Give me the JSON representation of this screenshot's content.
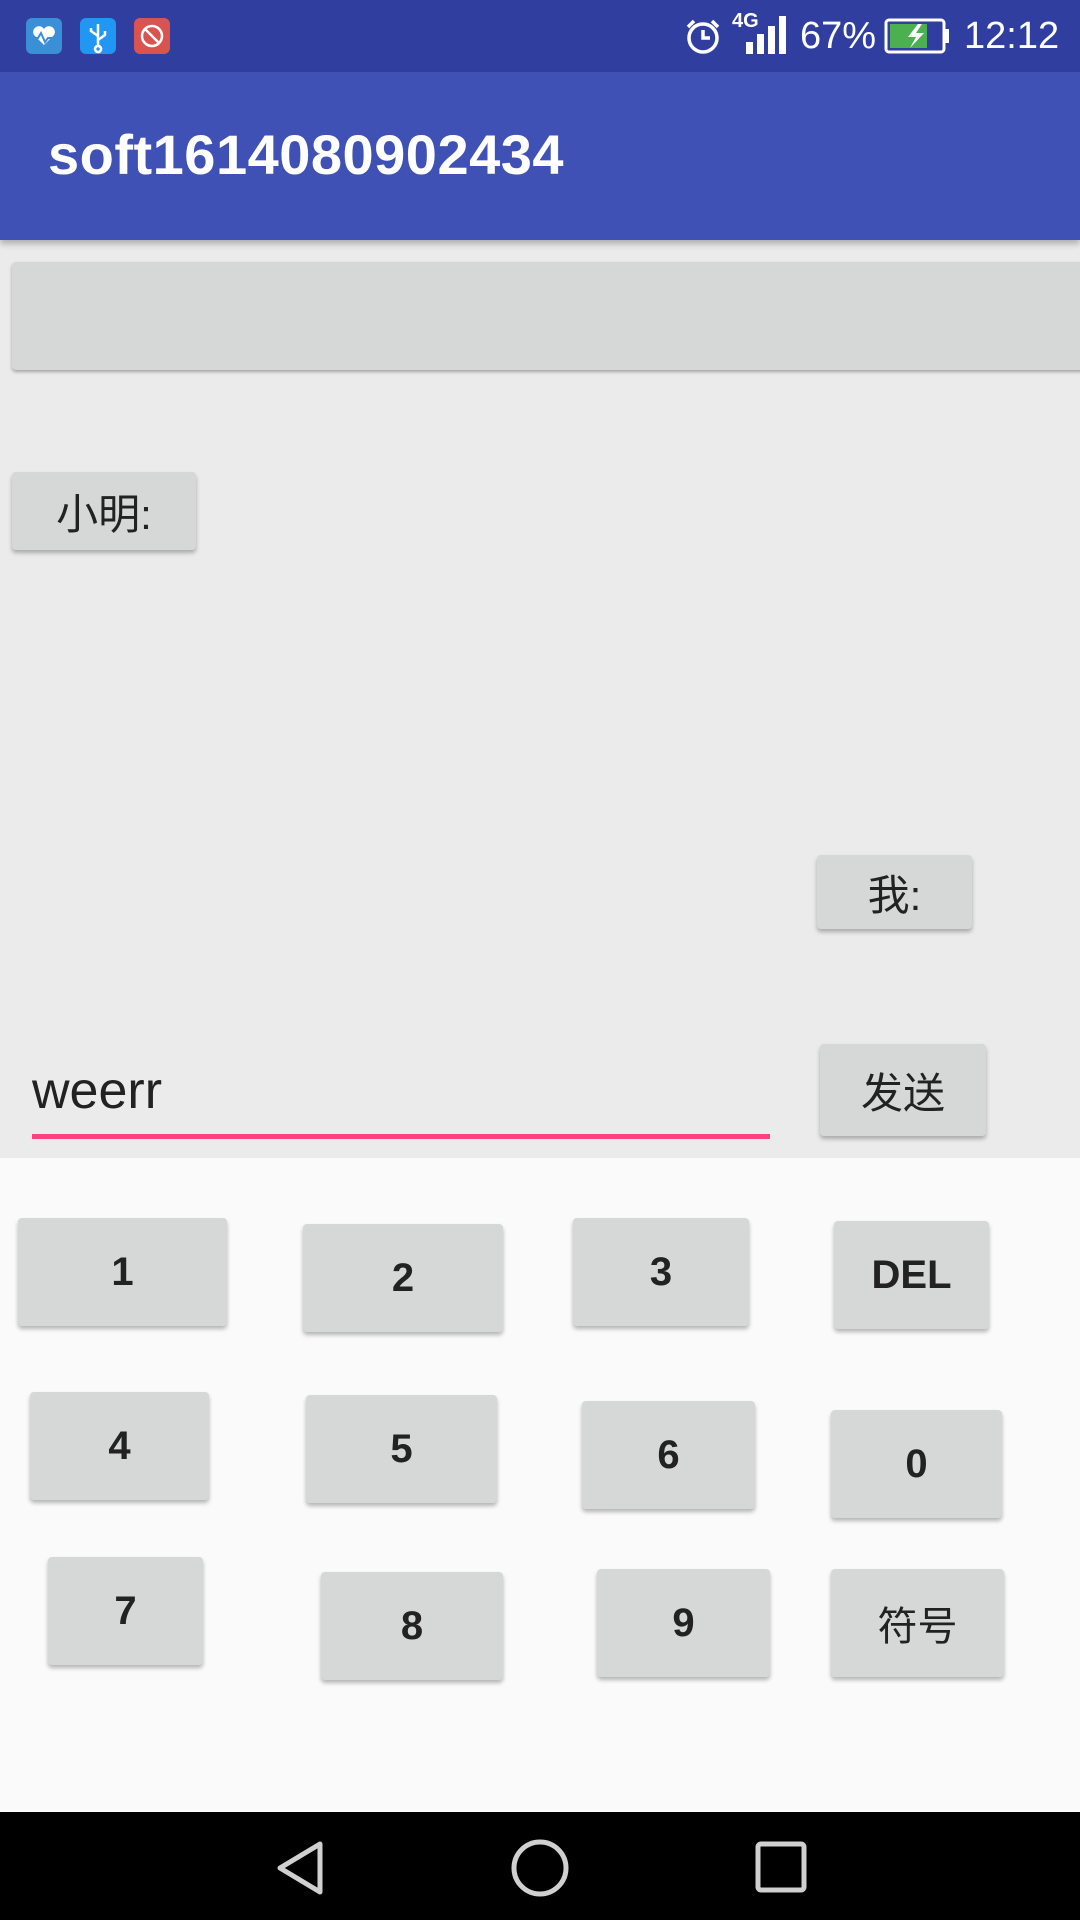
{
  "status_bar": {
    "icons": [
      "health-app-icon",
      "usb-icon",
      "blocked-app-icon"
    ],
    "network": "4G",
    "battery": "67%",
    "time": "12:12"
  },
  "app_bar": {
    "title": "soft1614080902434"
  },
  "chat": {
    "message_box": "",
    "xiaoming_label": "小明:",
    "me_label": "我:"
  },
  "compose": {
    "input_value": "weerr",
    "send_label": "发送"
  },
  "keypad": {
    "keys": [
      "1",
      "2",
      "3",
      "DEL",
      "4",
      "5",
      "6",
      "0",
      "7",
      "8",
      "9",
      "符号"
    ]
  },
  "nav_bar": {
    "icons": [
      "back-icon",
      "home-icon",
      "recents-icon"
    ]
  },
  "colors": {
    "status_bar": "#303f9f",
    "app_bar": "#3f51b5",
    "accent": "#ff4081",
    "button": "#d6d7d7"
  }
}
